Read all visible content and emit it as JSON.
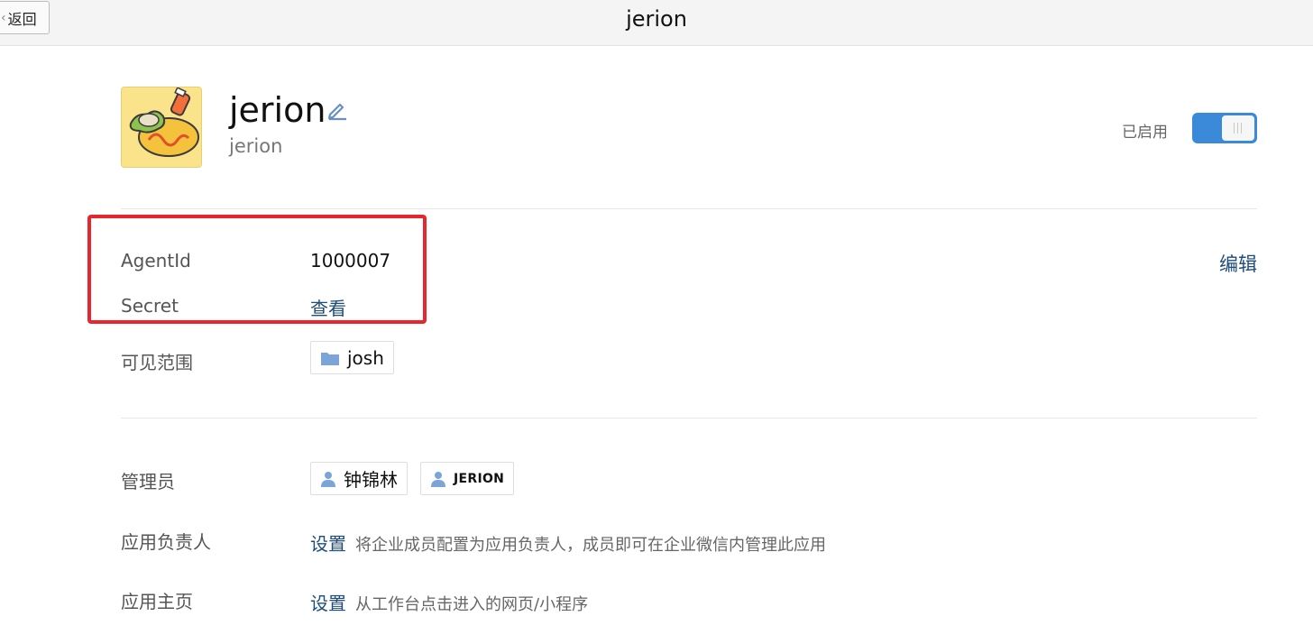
{
  "topbar": {
    "back_label": "返回",
    "title": "jerion"
  },
  "app": {
    "name": "jerion",
    "subtitle": "jerion",
    "status_label": "已启用",
    "enabled": true
  },
  "credentials": {
    "agentid_label": "AgentId",
    "agentid_value": "1000007",
    "secret_label": "Secret",
    "secret_link": "查看",
    "edit_link": "编辑"
  },
  "visibility": {
    "label": "可见范围",
    "dept_name": "josh"
  },
  "admins": {
    "label": "管理员",
    "users": [
      "钟锦林",
      "JERION"
    ]
  },
  "owner": {
    "label": "应用负责人",
    "link": "设置",
    "hint": "将企业成员配置为应用负责人，成员即可在企业微信内管理此应用"
  },
  "homepage": {
    "label": "应用主页",
    "link": "设置",
    "hint": "从工作台点击进入的网页/小程序"
  },
  "colors": {
    "accent": "#3b8ad9",
    "link": "#1e4c7c",
    "highlight": "#e8262d"
  }
}
